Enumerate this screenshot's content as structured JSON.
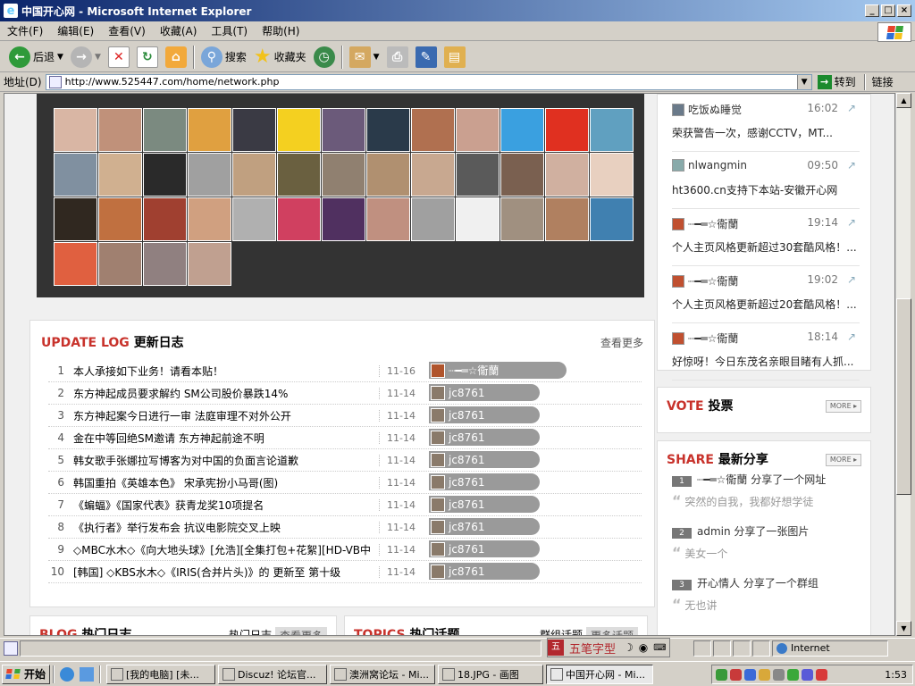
{
  "window": {
    "title": "中国开心网 - Microsoft Internet Explorer",
    "controls": [
      "_",
      "□",
      "×"
    ]
  },
  "menu": [
    "文件(F)",
    "编辑(E)",
    "查看(V)",
    "收藏(A)",
    "工具(T)",
    "帮助(H)"
  ],
  "toolbar": {
    "back": "后退",
    "search": "搜索",
    "favorites": "收藏夹"
  },
  "address": {
    "label": "地址(D)",
    "url": "http://www.525447.com/home/network.php",
    "go": "转到",
    "links": "链接"
  },
  "avatars": {
    "count": 43,
    "colors": [
      "#d9b6a4",
      "#c0917a",
      "#7b8a80",
      "#e0a040",
      "#3a3a44",
      "#f4d020",
      "#6b5a7a",
      "#2a3a4a",
      "#b07050",
      "#caa090",
      "#3aa0e0",
      "#e03020",
      "#60a0c0",
      "#8090a0",
      "#d0b090",
      "#2a2a2a",
      "#a0a0a0",
      "#c0a080",
      "#6a6040",
      "#908070",
      "#b09070",
      "#c8a890",
      "#5a5a5a",
      "#7a6050",
      "#d0b0a0",
      "#e8d0c0",
      "#302820",
      "#c07040",
      "#a04030",
      "#d0a080",
      "#b0b0b0",
      "#d04060",
      "#503060",
      "#c09080",
      "#a0a0a0",
      "#f0f0f0",
      "#a09080",
      "#b08060",
      "#4080b0",
      "#e06040",
      "#a08070",
      "#908080",
      "#c0a090"
    ]
  },
  "update_log": {
    "title_en": "UPDATE LOG",
    "title_cn": "更新日志",
    "more": "查看更多",
    "rows": [
      {
        "n": "1",
        "text": "本人承接如下业务！请看本贴！",
        "date": "11-16",
        "user": "┈━═☆衞蘭"
      },
      {
        "n": "2",
        "text": "东方神起成员要求解约 SM公司股价暴跌14%",
        "date": "11-14",
        "user": "jc8761"
      },
      {
        "n": "3",
        "text": "东方神起案今日进行一审 法庭审理不对外公开",
        "date": "11-14",
        "user": "jc8761"
      },
      {
        "n": "4",
        "text": "金在中等回绝SM邀请 东方神起前途不明",
        "date": "11-14",
        "user": "jc8761"
      },
      {
        "n": "5",
        "text": "韩女歌手张娜拉写博客为对中国的负面言论道歉",
        "date": "11-14",
        "user": "jc8761"
      },
      {
        "n": "6",
        "text": "韩国重拍《英雄本色》 宋承宪扮小马哥(图)",
        "date": "11-14",
        "user": "jc8761"
      },
      {
        "n": "7",
        "text": "《蝙蝠》《国家代表》获青龙奖10项提名",
        "date": "11-14",
        "user": "jc8761"
      },
      {
        "n": "8",
        "text": "《执行者》举行发布会 抗议电影院交叉上映",
        "date": "11-14",
        "user": "jc8761"
      },
      {
        "n": "9",
        "text": "◇MBC水木◇《向大地头球》[允浩][全集打包+花絮][HD-VB中",
        "date": "11-14",
        "user": "jc8761"
      },
      {
        "n": "10",
        "text": "[韩国] ◇KBS水木◇《IRIS(合并片头)》的 更新至 第十级",
        "date": "11-14",
        "user": "jc8761"
      }
    ]
  },
  "blog": {
    "title_en": "BLOG",
    "title_cn": "热门日志",
    "tab": "热门日志",
    "more": "查看更多"
  },
  "topics": {
    "title_en": "TOPICS",
    "title_cn": "热门话题",
    "tab": "群组话题",
    "more": "更多话题"
  },
  "feed": [
    {
      "name": "吃饭ぬ睡觉",
      "time": "16:02",
      "text": "荣获警告一次，感谢CCTV，MT..."
    },
    {
      "name": "nlwangmin",
      "time": "09:50",
      "text": "ht3600.cn支持下本站-安徽开心网"
    },
    {
      "name": "┈━═☆衞蘭",
      "time": "19:14",
      "text": "个人主页风格更新超过30套酷风格！..."
    },
    {
      "name": "┈━═☆衞蘭",
      "time": "19:02",
      "text": "个人主页风格更新超过20套酷风格！..."
    },
    {
      "name": "┈━═☆衞蘭",
      "time": "18:14",
      "text": "好惊呀！今日东茂名亲眼目睹有人抓..."
    }
  ],
  "vote": {
    "title_en": "VOTE",
    "title_cn": "投票",
    "more": "MORE ▸"
  },
  "share": {
    "title_en": "SHARE",
    "title_cn": "最新分享",
    "more": "MORE ▸",
    "items": [
      {
        "num": "1",
        "text": "┈━═☆衞蘭 分享了一个网址",
        "sub": "突然的自我，我都好想学徒"
      },
      {
        "num": "2",
        "text": "admin 分享了一张图片",
        "sub": "美女一个"
      },
      {
        "num": "3",
        "text": "开心情人 分享了一个群组",
        "sub": "无也讲"
      }
    ]
  },
  "status": {
    "zone": "Internet",
    "ime": "五笔字型"
  },
  "taskbar": {
    "start": "开始",
    "items": [
      "[我的电脑] [未...",
      "Discuz! 论坛官...",
      "澳洲窝论坛 - Mi...",
      "18.JPG - 画图",
      "中国开心网 - Mi..."
    ],
    "clock": "1:53"
  }
}
